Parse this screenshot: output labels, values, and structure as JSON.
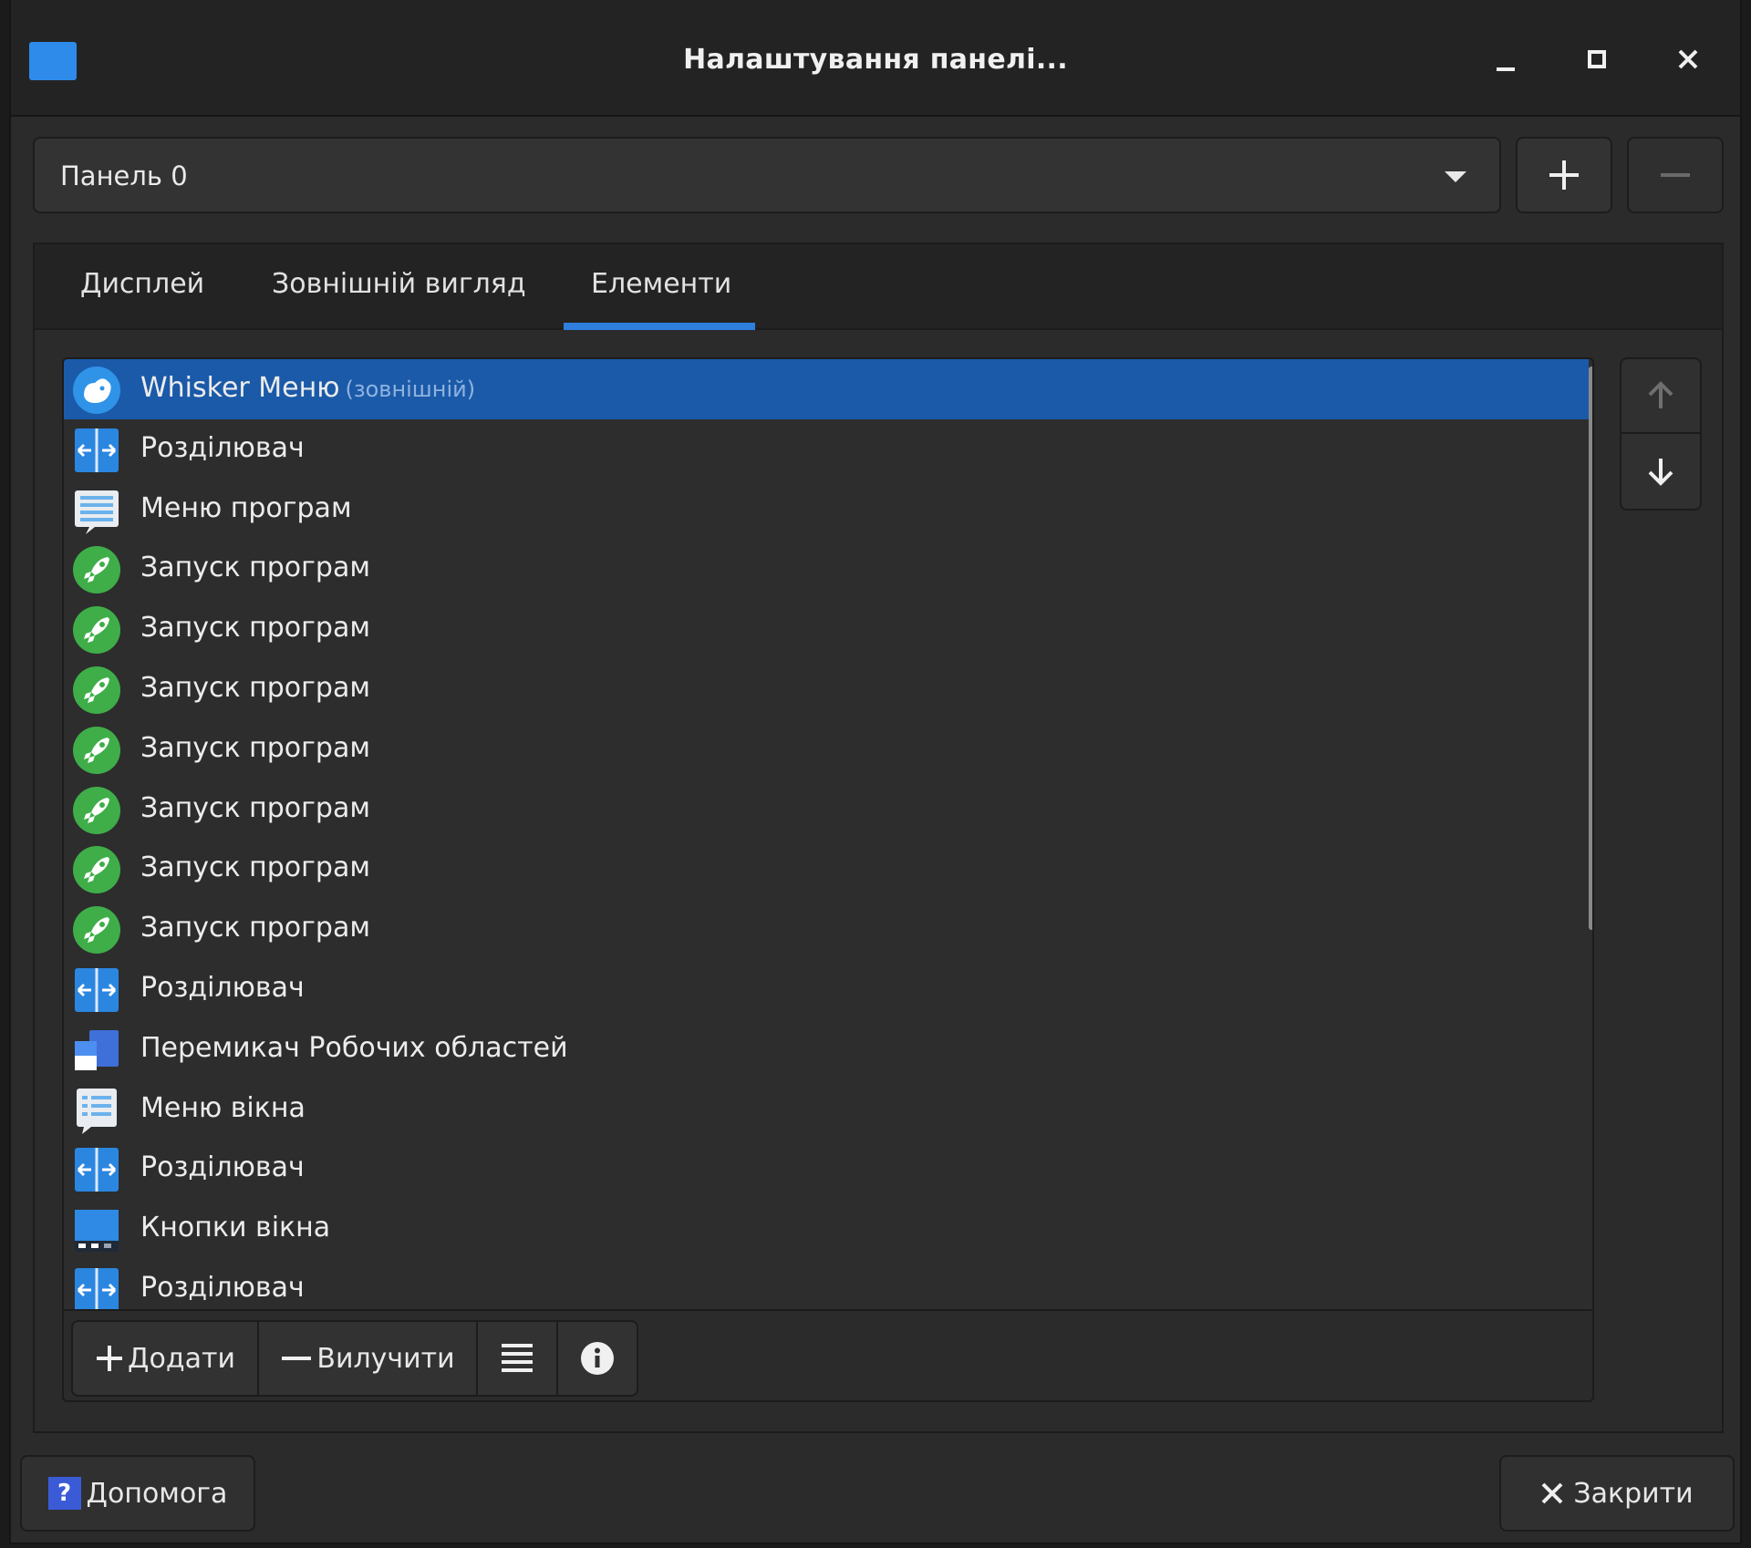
{
  "window": {
    "title": "Налаштування панелі..."
  },
  "panel_selector": {
    "value": "Панель 0"
  },
  "tabs": [
    {
      "label": "Дисплей"
    },
    {
      "label": "Зовнішній вигляд"
    },
    {
      "label": "Елементи",
      "active": true
    }
  ],
  "items": [
    {
      "label": "Whisker Меню",
      "sub": "(зовнішній)",
      "icon": "whisker-menu-icon",
      "selected": true
    },
    {
      "label": "Розділювач",
      "icon": "separator-icon"
    },
    {
      "label": "Меню програм",
      "icon": "applications-menu-icon"
    },
    {
      "label": "Запуск програм",
      "icon": "launcher-icon"
    },
    {
      "label": "Запуск програм",
      "icon": "launcher-icon"
    },
    {
      "label": "Запуск програм",
      "icon": "launcher-icon"
    },
    {
      "label": "Запуск програм",
      "icon": "launcher-icon"
    },
    {
      "label": "Запуск програм",
      "icon": "launcher-icon"
    },
    {
      "label": "Запуск програм",
      "icon": "launcher-icon"
    },
    {
      "label": "Запуск програм",
      "icon": "launcher-icon"
    },
    {
      "label": "Розділювач",
      "icon": "separator-icon"
    },
    {
      "label": "Перемикач Робочих областей",
      "icon": "workspace-switcher-icon"
    },
    {
      "label": "Меню вікна",
      "icon": "window-menu-icon"
    },
    {
      "label": "Розділювач",
      "icon": "separator-icon"
    },
    {
      "label": "Кнопки вікна",
      "icon": "window-buttons-icon"
    },
    {
      "label": "Розділювач",
      "icon": "separator-icon"
    }
  ],
  "list_toolbar": {
    "add_label": "Додати",
    "remove_label": "Вилучити"
  },
  "footer": {
    "help_label": "Допомога",
    "close_label": "Закрити"
  },
  "colors": {
    "accent": "#2f7fdf",
    "selection": "#1b5aa8",
    "launcher_green": "#3fae49",
    "separator_blue": "#2b86e0"
  }
}
